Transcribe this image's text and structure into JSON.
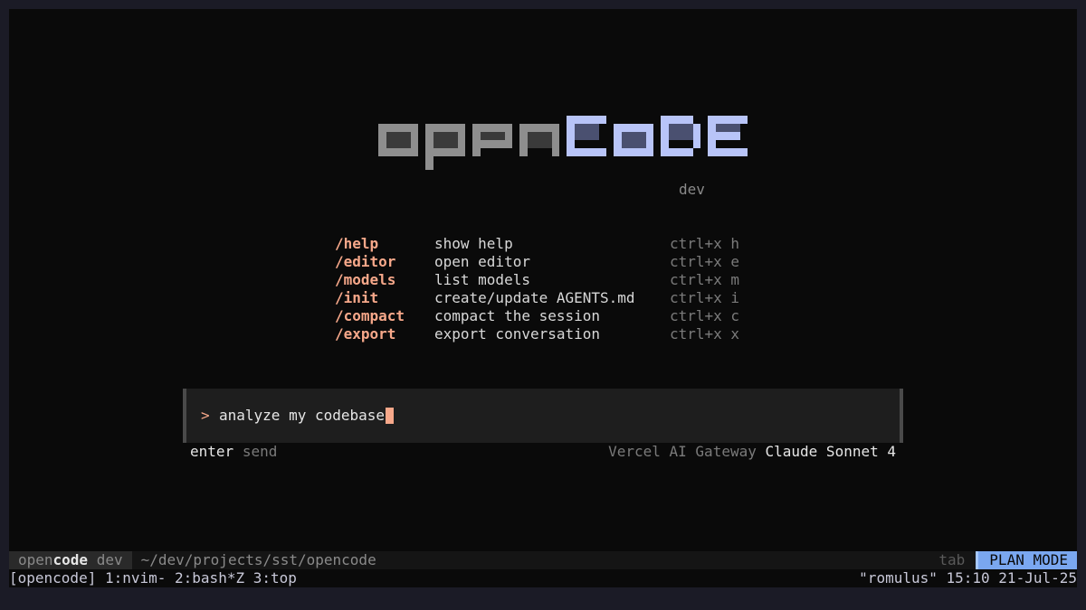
{
  "logo": {
    "word_left": "open",
    "word_right": "code",
    "subtitle": "dev",
    "colors": {
      "left": "#8e8e8e",
      "right": "#b8c4f8",
      "shade": "#3a3a3a",
      "shade_right": "#4a5070"
    }
  },
  "commands": [
    {
      "name": "/help",
      "desc": "show help",
      "key": "ctrl+x h"
    },
    {
      "name": "/editor",
      "desc": "open editor",
      "key": "ctrl+x e"
    },
    {
      "name": "/models",
      "desc": "list models",
      "key": "ctrl+x m"
    },
    {
      "name": "/init",
      "desc": "create/update AGENTS.md",
      "key": "ctrl+x i"
    },
    {
      "name": "/compact",
      "desc": "compact the session",
      "key": "ctrl+x c"
    },
    {
      "name": "/export",
      "desc": "export conversation",
      "key": "ctrl+x x"
    }
  ],
  "input": {
    "prompt": ">",
    "value": "analyze my codebase"
  },
  "hints": {
    "enter_key": "enter",
    "enter_action": "send",
    "provider": "Vercel AI Gateway",
    "model": "Claude Sonnet 4"
  },
  "statusbar": {
    "app_prefix": "open",
    "app_bold": "code",
    "app_suffix": "dev",
    "cwd": "~/dev/projects/sst/opencode",
    "tab_hint": "tab",
    "mode": "PLAN MODE"
  },
  "tmux": {
    "left": "[opencode] 1:nvim- 2:bash*Z 3:top",
    "right": "\"romulus\" 15:10 21-Jul-25"
  },
  "colors": {
    "accent": "#f7a88a",
    "mode_badge": "#7aa7f0",
    "background": "#0a0a0a"
  }
}
